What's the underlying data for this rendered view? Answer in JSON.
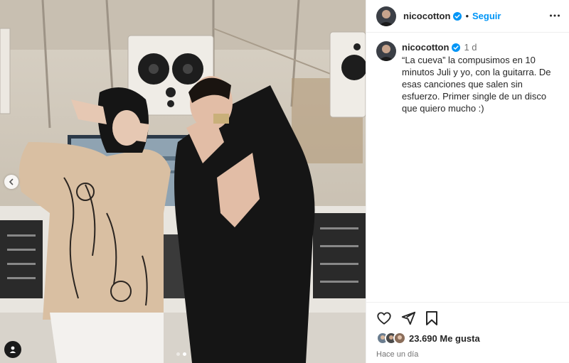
{
  "header": {
    "username": "nicocotton",
    "separator": "•",
    "follow_label": "Seguir"
  },
  "caption": {
    "username": "nicocotton",
    "time": "1 d",
    "text": "“La cueva” la compusimos en 10 minutos Juli y yo, con la guitarra. De esas canciones que salen sin esfuerzo. Primer single de un disco que quiero mucho :)"
  },
  "footer": {
    "likes": "23.690 Me gusta",
    "date": "Hace un día"
  },
  "carousel": {
    "current": 2,
    "total": 2
  },
  "icons": [
    "more-icon",
    "heart-icon",
    "share-icon",
    "bookmark-icon",
    "chevron-left-icon",
    "user-tag-icon",
    "verified-icon"
  ],
  "colors": {
    "accent": "#0095f6",
    "text": "#262626",
    "muted": "#737373"
  }
}
